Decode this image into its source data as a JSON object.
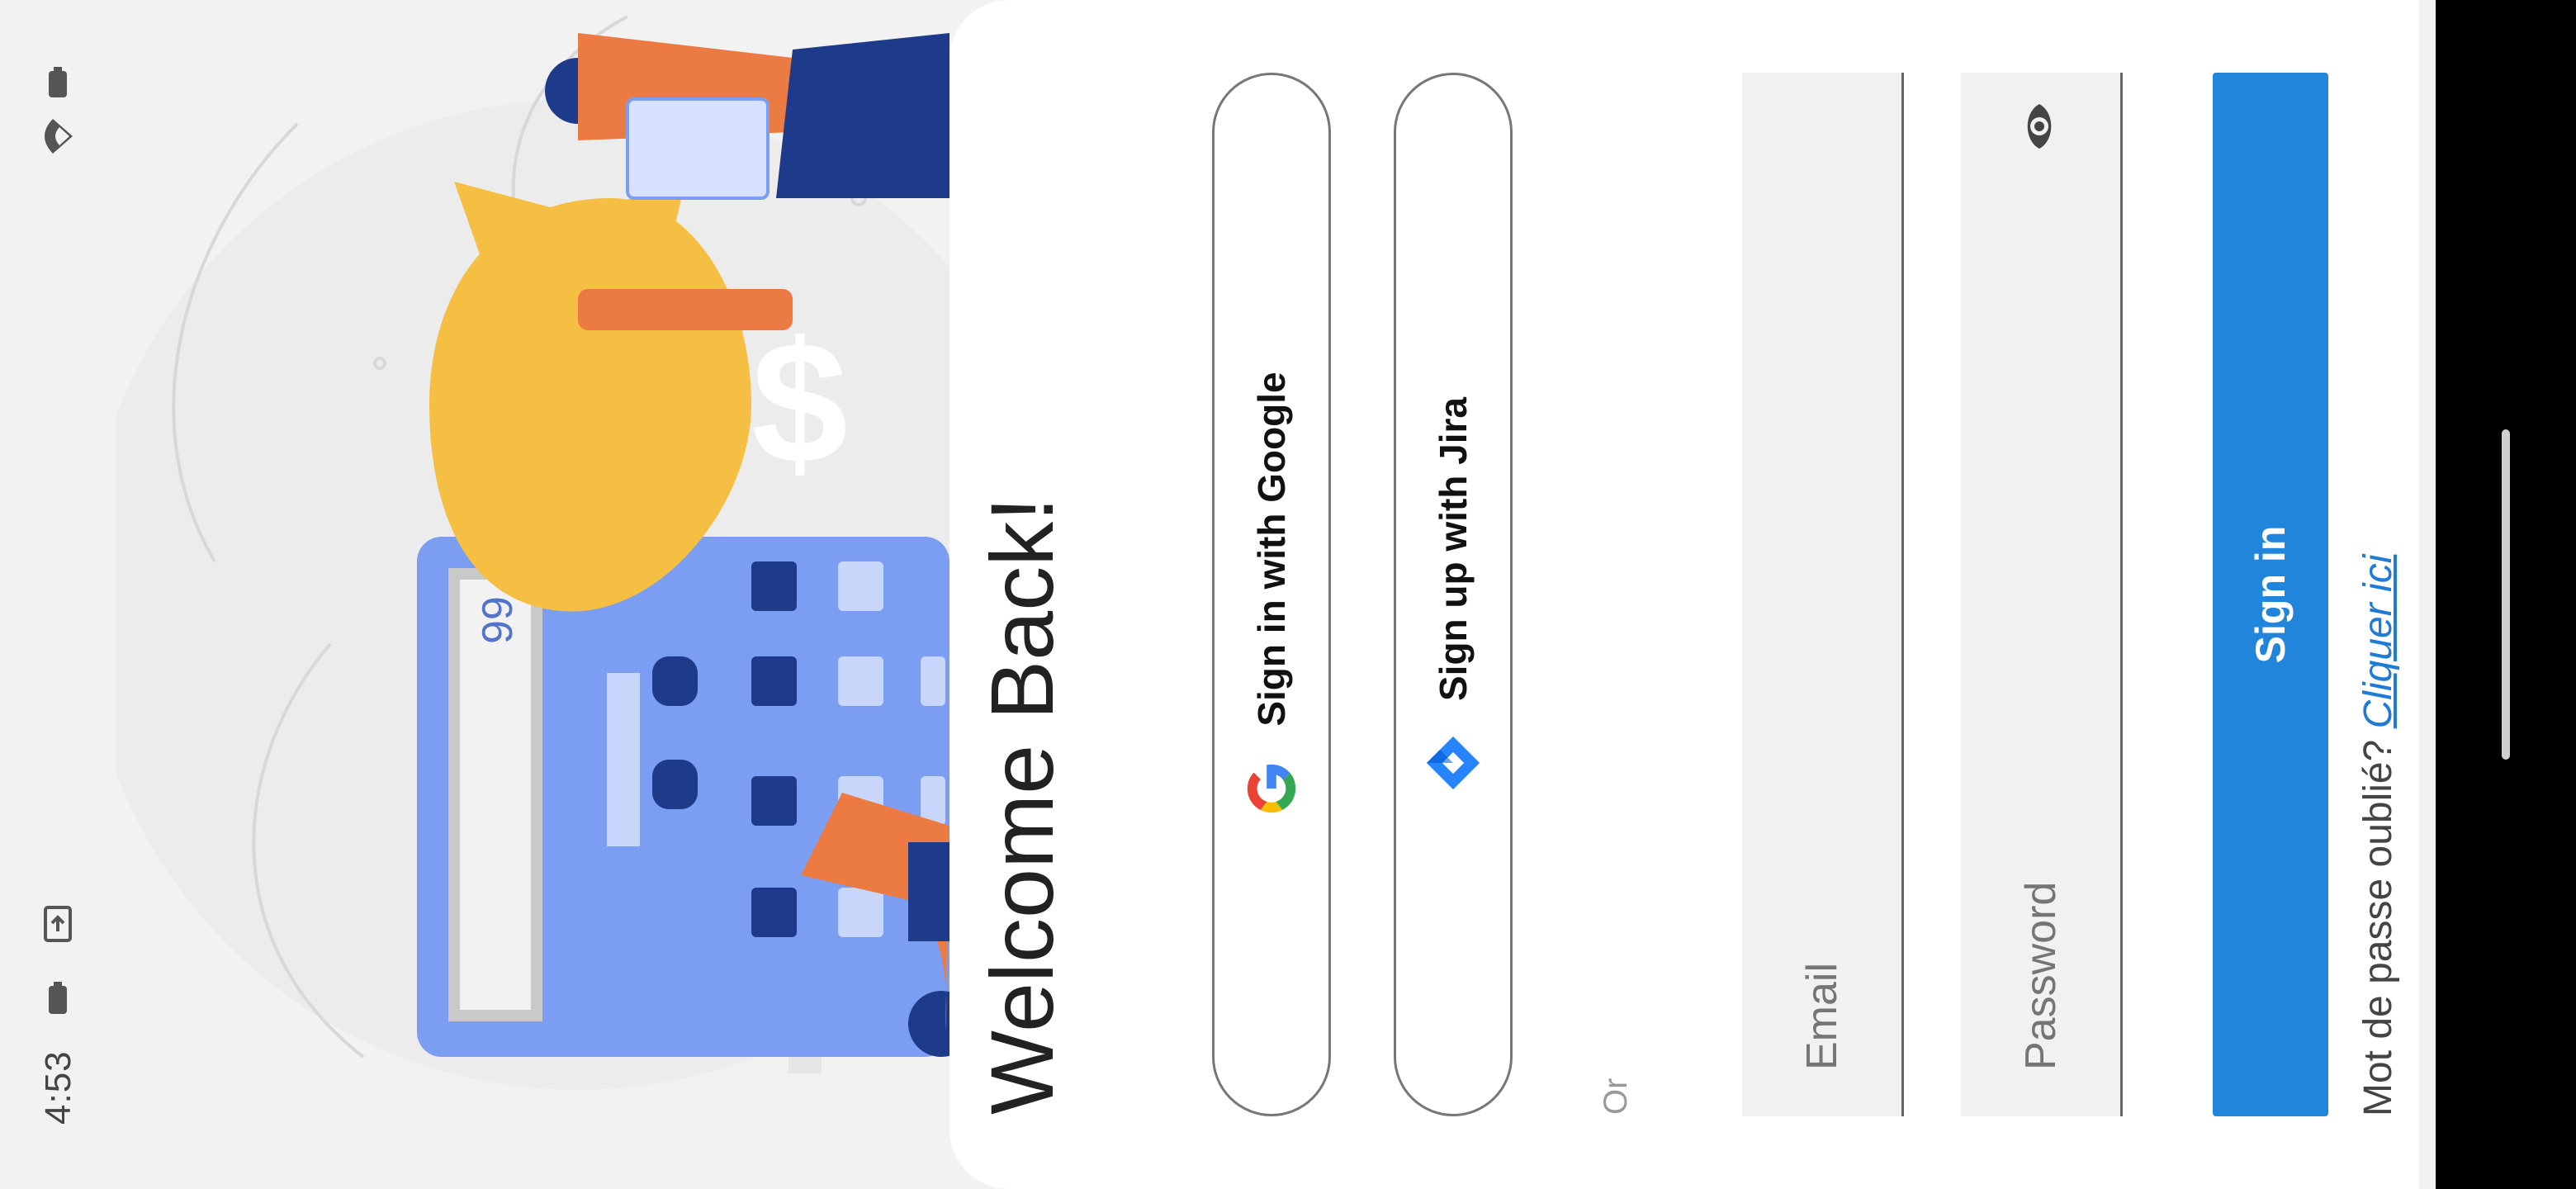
{
  "status_bar": {
    "time": "4:53"
  },
  "illustration": {
    "calculator_display": "99",
    "bag_symbol": "$"
  },
  "login": {
    "title": "Welcome Back!",
    "google_button": "Sign in with Google",
    "jira_button": "Sign up with Jira",
    "or_text": "Or",
    "email_placeholder": "Email",
    "password_placeholder": "Password",
    "sign_in_button": "Sign in",
    "forgot_text": "Mot de passe oublié?",
    "forgot_link": "Cliquer ici"
  },
  "colors": {
    "primary": "#2285dc",
    "link": "#1e7bd6",
    "illustration_blue": "#7b9ef2",
    "illustration_navy": "#1e3a8a",
    "illustration_gold": "#f5bf43",
    "illustration_orange": "#ec7b43"
  }
}
